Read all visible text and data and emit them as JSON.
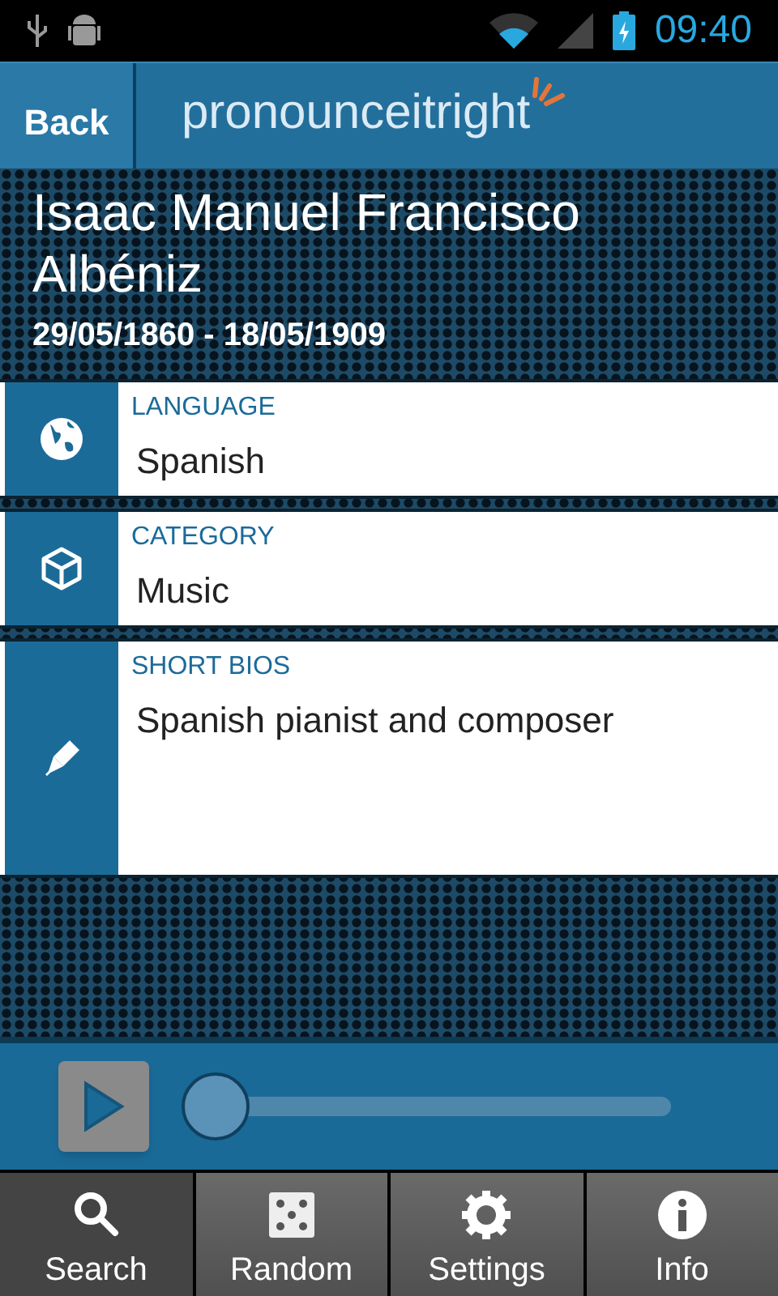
{
  "status_bar": {
    "time": "09:40"
  },
  "header": {
    "back": "Back",
    "logo": "pronounceitright"
  },
  "person": {
    "name": "Isaac Manuel Francisco Albéniz",
    "dates": "29/05/1860 - 18/05/1909"
  },
  "fields": [
    {
      "label": "LANGUAGE",
      "value": "Spanish"
    },
    {
      "label": "CATEGORY",
      "value": "Music"
    },
    {
      "label": "SHORT BIOS",
      "value": "Spanish pianist and composer"
    }
  ],
  "player": {
    "level": 0
  },
  "tabs": [
    {
      "label": "Search",
      "selected": true
    },
    {
      "label": "Random",
      "selected": false
    },
    {
      "label": "Settings",
      "selected": false
    },
    {
      "label": "Info",
      "selected": false
    }
  ]
}
